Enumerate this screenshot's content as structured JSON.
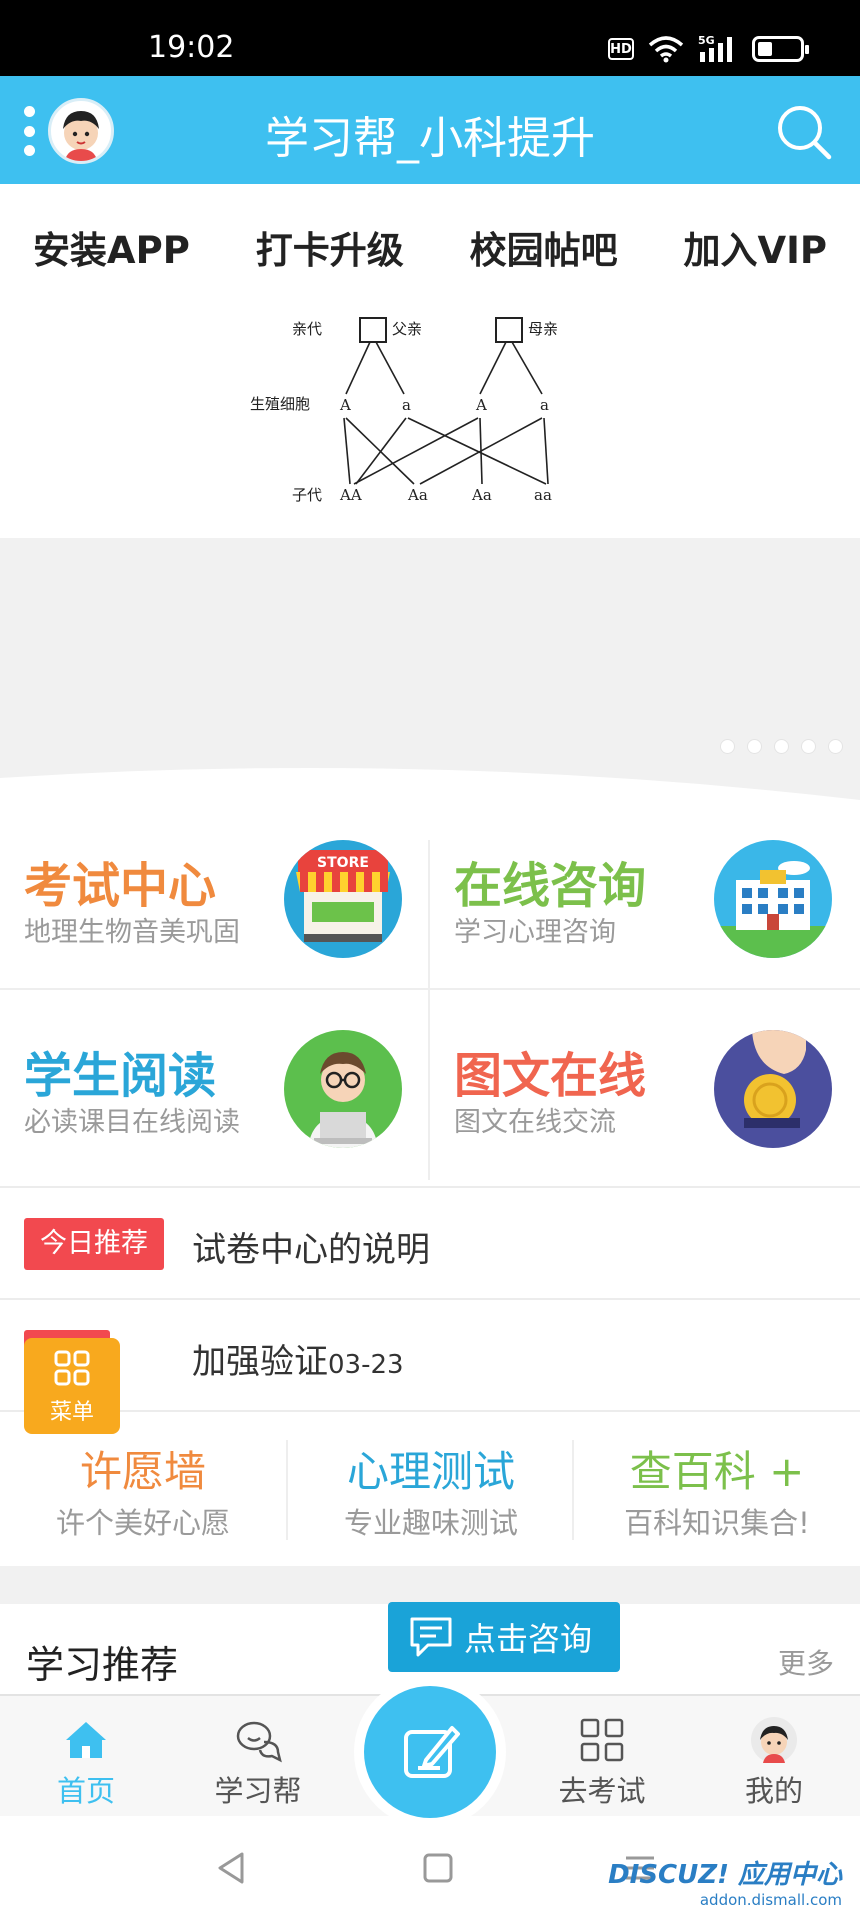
{
  "status_bar": {
    "time": "19:02",
    "hd": "HD",
    "network": "5G"
  },
  "header": {
    "title": "学习帮_小科提升"
  },
  "top_nav": {
    "items": [
      "安装APP",
      "打卡升级",
      "校园帖吧",
      "加入VIP"
    ]
  },
  "banner": {
    "diagram": {
      "row_parents": "亲代",
      "father": "父亲",
      "mother": "母亲",
      "row_gametes": "生殖细胞",
      "gametes": [
        "A",
        "a",
        "A",
        "a"
      ],
      "row_offspring": "子代",
      "offspring": [
        "AA",
        "Aa",
        "Aa",
        "aa"
      ]
    },
    "slide_count": 5
  },
  "features": [
    {
      "title": "考试中心",
      "subtitle": "地理生物音美巩固",
      "color": "#f08a3e",
      "icon": "store-icon"
    },
    {
      "title": "在线咨询",
      "subtitle": "学习心理咨询",
      "color": "#7cc04b",
      "icon": "building-icon"
    },
    {
      "title": "学生阅读",
      "subtitle": "必读课目在线阅读",
      "color": "#2aa6d8",
      "icon": "reader-avatar-icon"
    },
    {
      "title": "图文在线",
      "subtitle": "图文在线交流",
      "color": "#f0654f",
      "icon": "coin-icon"
    }
  ],
  "announcements": [
    {
      "tag": "今日推荐",
      "text": "试卷中心的说明",
      "date": ""
    },
    {
      "tag": "公告",
      "text": "加强验证",
      "date": "03-23"
    }
  ],
  "float_menu": {
    "label": "菜单"
  },
  "services": [
    {
      "title": "许愿墙",
      "subtitle": "许个美好心愿",
      "color": "#f08a3e"
    },
    {
      "title": "心理测试",
      "subtitle": "专业趣味测试",
      "color": "#2aa6d8"
    },
    {
      "title": "查百科 +",
      "subtitle": "百科知识集合!",
      "color": "#7cc04b"
    }
  ],
  "study": {
    "title": "学习推荐",
    "more": "更多"
  },
  "consult": {
    "label": "点击咨询"
  },
  "tabbar": {
    "items": [
      "首页",
      "学习帮",
      "去考试",
      "我的"
    ],
    "active": "首页"
  },
  "watermark": {
    "main": "DISCUZ! 应用中心",
    "sub": "addon.dismall.com"
  },
  "colors": {
    "header_bg": "#3ec0f0",
    "tag_red": "#f2494f",
    "menu_orange": "#f8a91e",
    "consult_blue": "#1aa3d8"
  }
}
